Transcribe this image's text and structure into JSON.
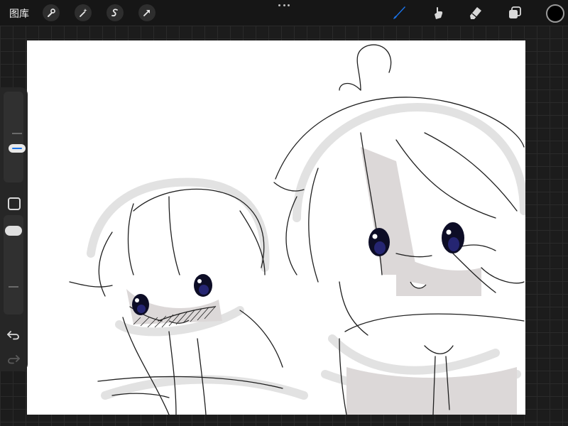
{
  "topbar": {
    "gallery_label": "图库",
    "tools_left": [
      "wrench-icon",
      "magic-wand-icon",
      "selection-icon",
      "arrow-icon"
    ],
    "tools_right": [
      "brush-icon",
      "smudge-icon",
      "eraser-icon",
      "layers-icon"
    ],
    "more_icon": "ellipsis-icon",
    "active_tool": "brush-icon",
    "current_color": "#000000",
    "accent_color": "#1a73e8"
  },
  "sidebar": {
    "controls": [
      "brush-size-slider",
      "modify-button",
      "opacity-slider",
      "undo-button",
      "redo-button"
    ]
  }
}
